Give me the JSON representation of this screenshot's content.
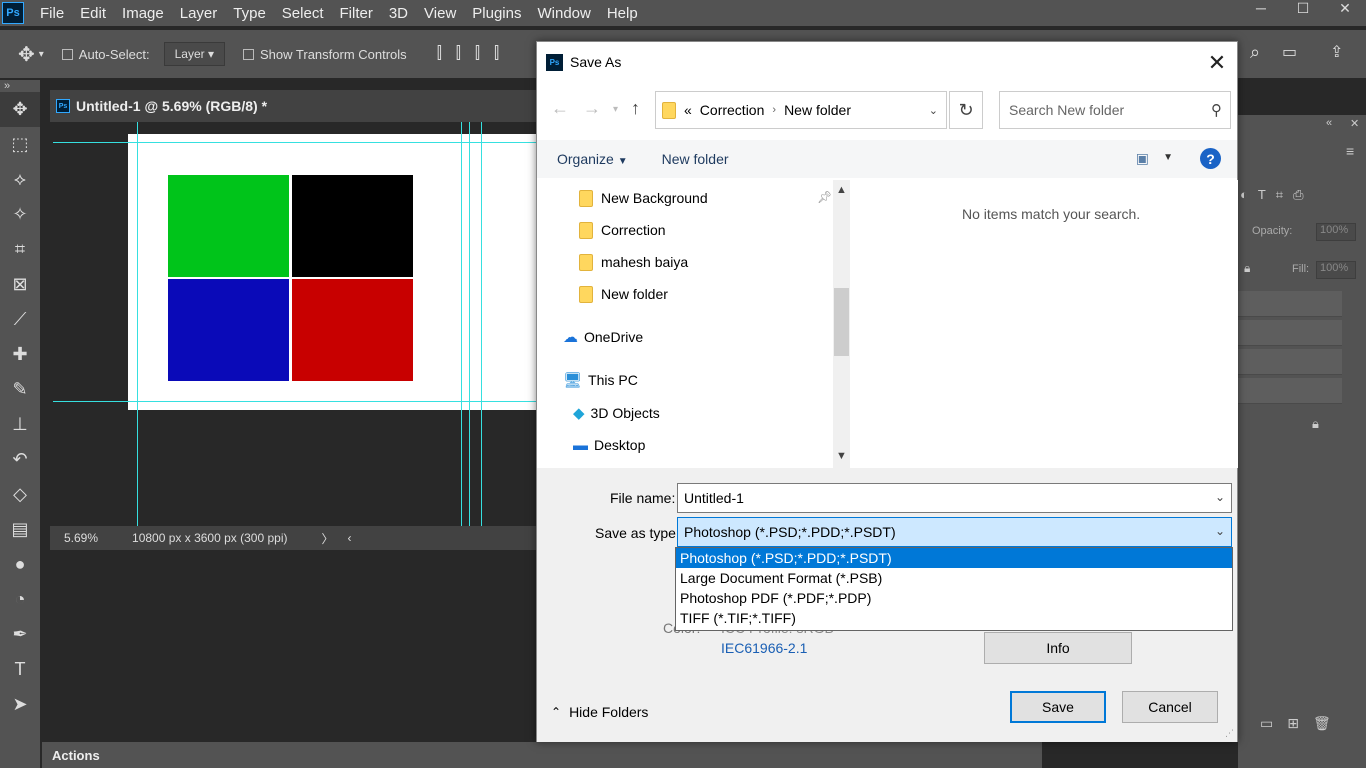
{
  "photoshop": {
    "logo": "Ps",
    "menu": [
      "File",
      "Edit",
      "Image",
      "Layer",
      "Type",
      "Select",
      "Filter",
      "3D",
      "View",
      "Plugins",
      "Window",
      "Help"
    ],
    "options": {
      "auto_select_label": "Auto-Select:",
      "auto_select_value": "Layer",
      "show_transform_label": "Show Transform Controls"
    },
    "document_tab": "Untitled-1 @ 5.69% (RGB/8) *",
    "status": {
      "zoom": "5.69%",
      "dimensions": "10800 px x 3600 px (300 ppi)"
    },
    "panel_actions": "Actions",
    "layers_panel": {
      "opacity_label": "Opacity:",
      "opacity_value": "100%",
      "fill_label": "Fill:",
      "fill_value": "100%"
    },
    "canvas_colors": {
      "top_left": "#00c41a",
      "top_right": "#000000",
      "bottom_left": "#0a0ab8",
      "bottom_right": "#c80000"
    }
  },
  "dialog": {
    "title": "Save As",
    "breadcrumb": [
      "«",
      "Correction",
      "New folder"
    ],
    "search_placeholder": "Search New folder",
    "toolbar": {
      "organize": "Organize",
      "new_folder": "New folder"
    },
    "tree": [
      {
        "label": "New Background",
        "icon": "folder-icon",
        "pinned": true
      },
      {
        "label": "Correction",
        "icon": "folder-icon"
      },
      {
        "label": "mahesh baiya",
        "icon": "folder-icon"
      },
      {
        "label": "New folder",
        "icon": "folder-icon"
      },
      {
        "label": "OneDrive",
        "icon": "onedrive-icon"
      },
      {
        "label": "This PC",
        "icon": "pc-icon"
      },
      {
        "label": "3D Objects",
        "icon": "3d-objects-icon"
      },
      {
        "label": "Desktop",
        "icon": "desktop-icon"
      }
    ],
    "empty_message": "No items match your search.",
    "file_name_label": "File name:",
    "file_name_value": "Untitled-1",
    "save_type_label": "Save as type:",
    "save_type_value": "Photoshop (*.PSD;*.PDD;*.PSDT)",
    "save_type_options": [
      "Photoshop (*.PSD;*.PDD;*.PSDT)",
      "Large Document Format (*.PSB)",
      "Photoshop PDF (*.PDF;*.PDP)",
      "TIFF (*.TIF;*.TIFF)"
    ],
    "color_partial": "Color:",
    "icc_partial": "ICC Profile: sRGB",
    "icc_line2": "IEC61966-2.1",
    "info_button": "Info",
    "hide_folders": "Hide Folders",
    "save_button": "Save",
    "cancel_button": "Cancel"
  }
}
